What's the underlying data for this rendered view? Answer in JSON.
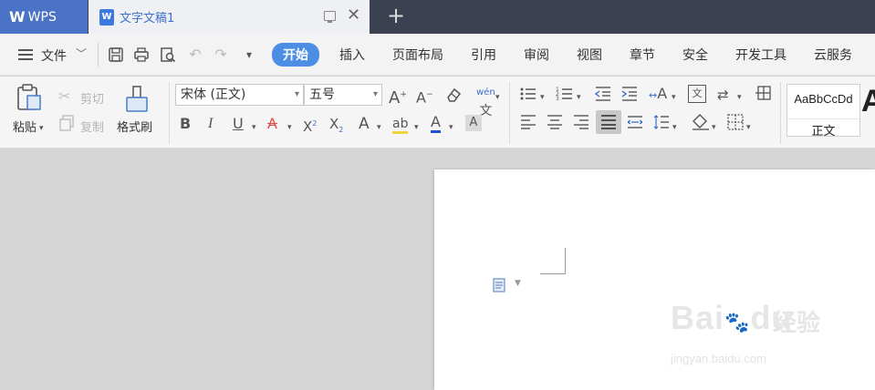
{
  "titlebar": {
    "app_tab": "WPS",
    "doc_tab": "文字文稿1"
  },
  "menubar": {
    "file_label": "文件",
    "items": [
      "开始",
      "插入",
      "页面布局",
      "引用",
      "审阅",
      "视图",
      "章节",
      "安全",
      "开发工具",
      "云服务"
    ]
  },
  "ribbon": {
    "paste_label": "粘贴",
    "cut_label": "剪切",
    "copy_label": "复制",
    "format_painter_label": "格式刷",
    "font_name": "宋体 (正文)",
    "font_size": "五号",
    "style_sample": "AaBbCcDd",
    "style_name": "正文",
    "style_next": "A"
  },
  "watermark": {
    "main": "Bai",
    "du": "du",
    "cn": "经验",
    "url": "jingyan.baidu.com"
  },
  "colors": {
    "titlebar_bg": "#3b4150",
    "app_tab_bg": "#4a73c6",
    "active_menu_bg": "#4d8ee5",
    "font_color_bar": "#1f4fd8",
    "strike_color": "#e24a4a"
  }
}
